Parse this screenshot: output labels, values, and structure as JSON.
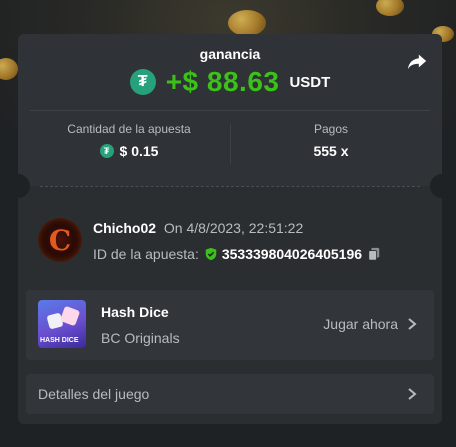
{
  "win": {
    "label": "ganancia",
    "amount": "+$ 88.63",
    "currency": "USDT",
    "currency_icon": "tether-icon",
    "amount_color": "#3bc117"
  },
  "stats": {
    "bet_amount_label": "Cantidad de la apuesta",
    "bet_amount_value": "$ 0.15",
    "payout_label": "Pagos",
    "payout_value": "555 x"
  },
  "user": {
    "name": "Chicho02",
    "date": "On 4/8/2023, 22:51:22",
    "bet_id_label": "ID de la apuesta:",
    "bet_id": "353339804026405196"
  },
  "game": {
    "title": "Hash Dice",
    "provider": "BC Originals",
    "thumb_text": "HASH DICE",
    "play_label": "Jugar ahora"
  },
  "details": {
    "label": "Detalles del juego"
  },
  "icons": {
    "share": "share-icon",
    "verified": "shield-check-icon",
    "copy": "copy-icon",
    "chevron": "chevron-right-icon"
  },
  "colors": {
    "background": "#1f2224",
    "card": "#2b2e31",
    "tether": "#26a17b",
    "verified": "#3bc117"
  }
}
